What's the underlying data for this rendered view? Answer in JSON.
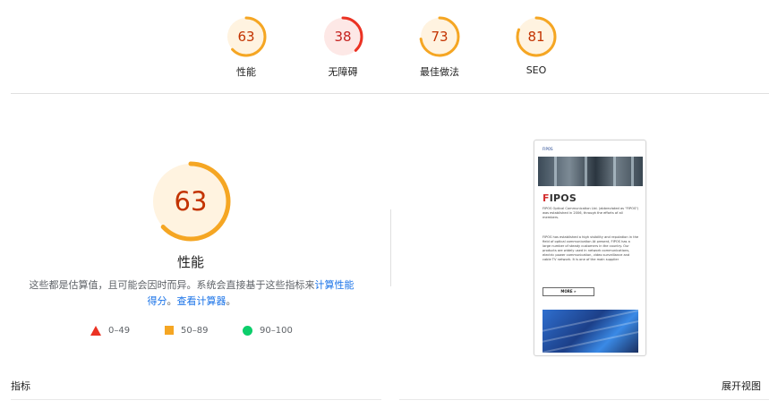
{
  "categories": [
    {
      "id": "performance",
      "score": 63,
      "label": "性能",
      "color": "#f5a623",
      "bg": "#fff3e0",
      "text_color": "#c33300",
      "fraction": 0.63
    },
    {
      "id": "accessibility",
      "score": 38,
      "label": "无障碍",
      "color": "#eb3223",
      "bg": "#fde8e6",
      "text_color": "#c5221f",
      "fraction": 0.38
    },
    {
      "id": "best-practices",
      "score": 73,
      "label": "最佳做法",
      "color": "#f5a623",
      "bg": "#fff3e0",
      "text_color": "#c33300",
      "fraction": 0.73
    },
    {
      "id": "seo",
      "score": 81,
      "label": "SEO",
      "color": "#f5a623",
      "bg": "#fff3e0",
      "text_color": "#c33300",
      "fraction": 0.81
    }
  ],
  "main": {
    "score": 63,
    "fraction": 0.63,
    "title": "性能",
    "description_prefix": "这些都是估算值，且可能会因时而异。系统会直接基于这些指标来",
    "link_calc": "计算性能得分",
    "description_mid": "。",
    "link_calculator": "查看计算器",
    "description_suffix": "。"
  },
  "legend": [
    {
      "shape": "triangle-icon",
      "range": "0–49",
      "color": "#eb3223"
    },
    {
      "shape": "square-icon",
      "range": "50–89",
      "color": "#f5a623"
    },
    {
      "shape": "circle-icon",
      "range": "90–100",
      "color": "#0cce6b"
    }
  ],
  "screenshot": {
    "logo": "FIPOS",
    "brand_first_letter": "F",
    "brand_rest": "IPOS",
    "paragraph1": "FIPOS Optical Communication Ltd. (abbreviated as \"FIPOS\") was established in 2006, through the efforts of all members.",
    "paragraph2": "FIPOS has established a high visibility and reputation in the field of optical communication At present, FIPOS has a large number of steady customers in the country. Our products are widely used in network communications, electric power communication, video surveillance and cable TV network. It is one of the main supplier",
    "more_button": "MORE »"
  },
  "footer": {
    "metrics_label": "指标",
    "expand_view": "展开视图"
  }
}
